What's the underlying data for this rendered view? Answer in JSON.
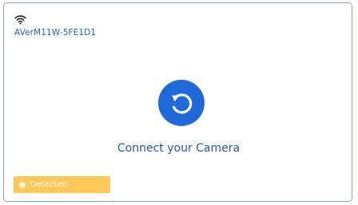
{
  "camera_card": {
    "device_name": "AVerM11W-5FE1D1",
    "wifi_icon": "wifi-icon",
    "connect_icon": "refresh-icon",
    "connect_label": "Connect your Camera",
    "status": {
      "label": "Detected",
      "color": "#ffc65a"
    }
  },
  "colors": {
    "accent": "#1f6ad8",
    "card_border": "#7fa6dc"
  }
}
